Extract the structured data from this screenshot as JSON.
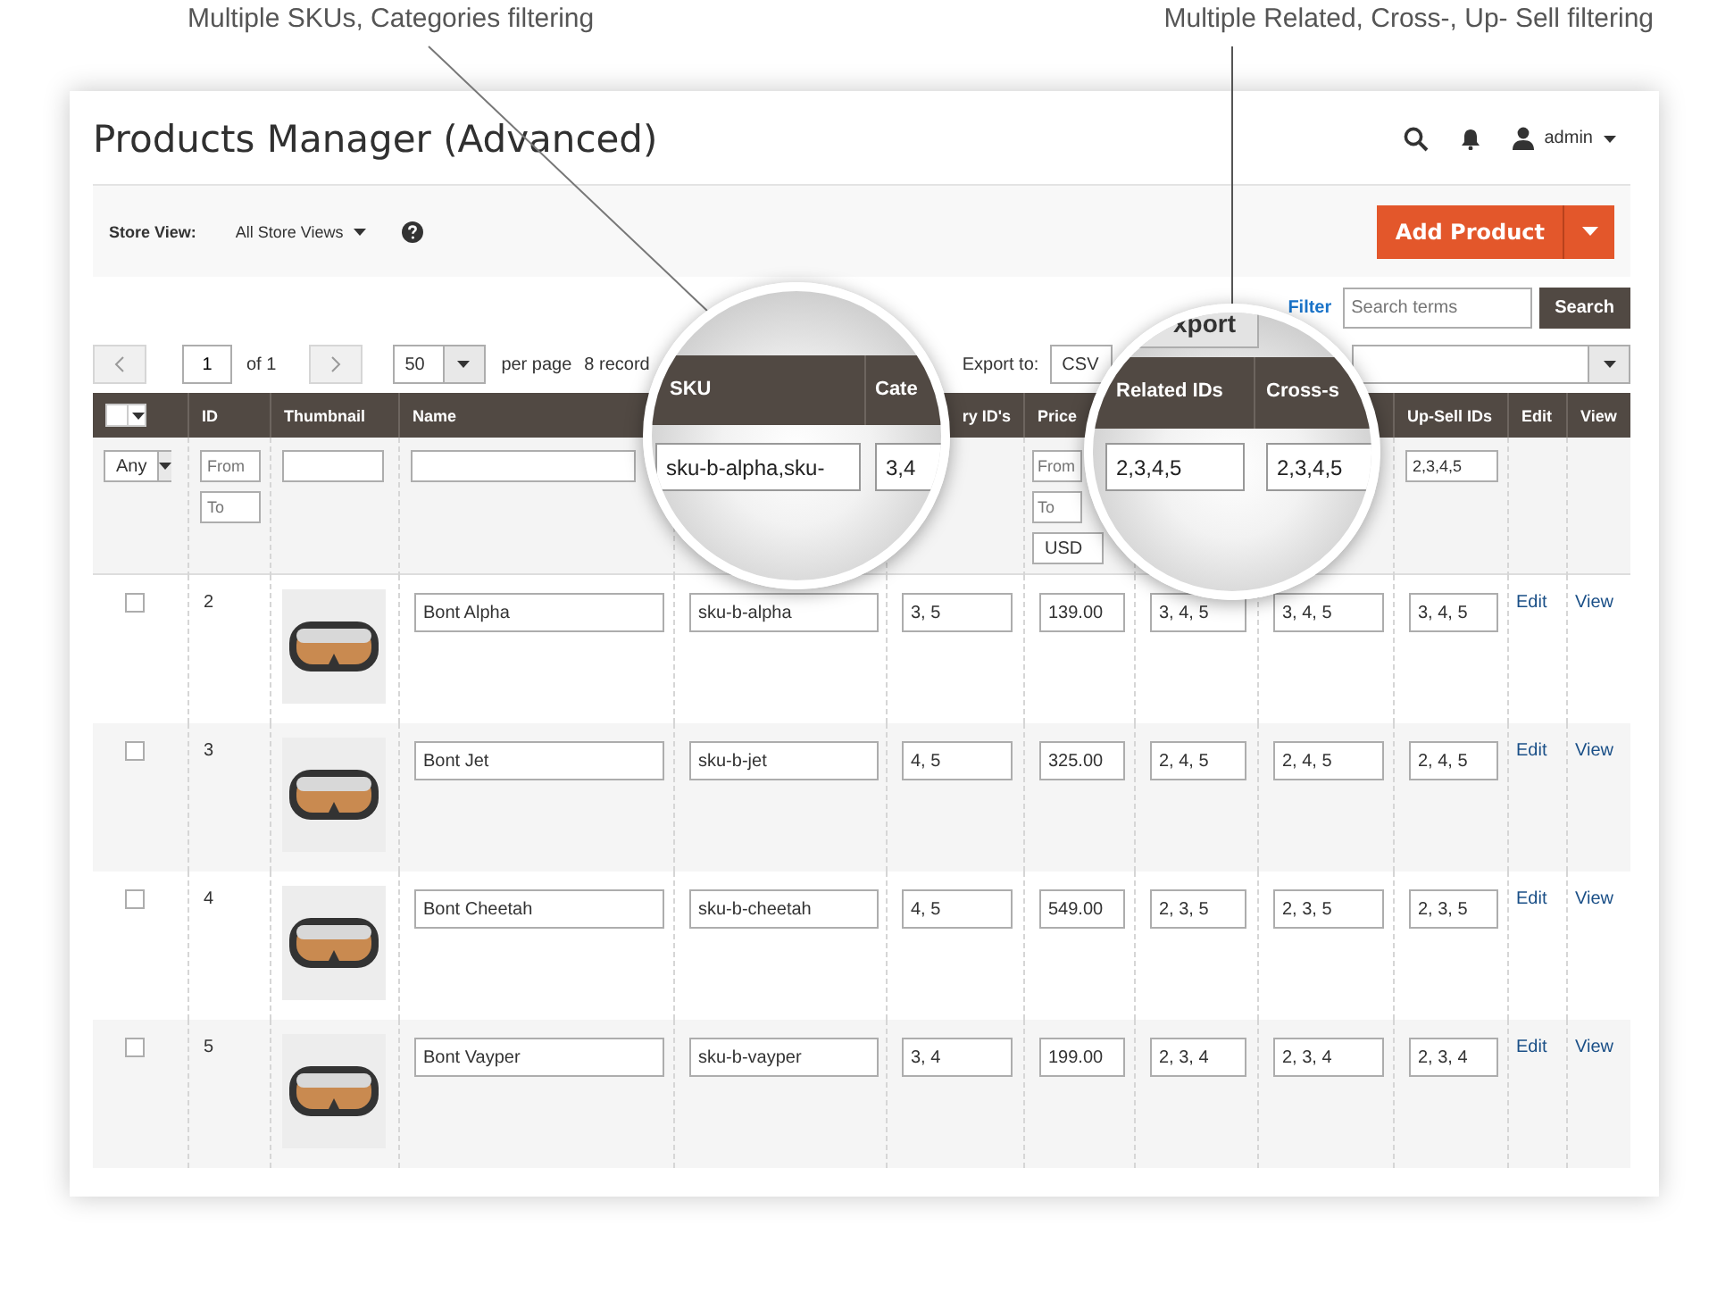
{
  "annotations": [
    {
      "text": "Multiple SKUs, Categories filtering"
    },
    {
      "text": "Multiple Related, Cross-, Up- Sell filtering"
    }
  ],
  "header": {
    "title": "Products Manager (Advanced)",
    "user": "admin"
  },
  "store_view": {
    "label": "Store View:",
    "value": "All Store Views"
  },
  "add_product": "Add Product",
  "toolbar": {
    "filter_link": "Filter",
    "search_placeholder": "Search terms",
    "search_button": "Search"
  },
  "pager": {
    "page": "1",
    "of": "of 1",
    "per_page_value": "50",
    "per_page_label": "per page",
    "records": "8 record"
  },
  "export": {
    "label": "Export to:",
    "format": "CSV"
  },
  "columns": [
    {
      "kind": "select"
    },
    {
      "kind": "text",
      "label": "ID"
    },
    {
      "kind": "text",
      "label": "Thumbnail"
    },
    {
      "kind": "text",
      "label": "Name"
    },
    {
      "kind": "covered"
    },
    {
      "kind": "text",
      "label": "ry ID's"
    },
    {
      "kind": "text",
      "label": "Price"
    },
    {
      "kind": "covered"
    },
    {
      "kind": "covered"
    },
    {
      "kind": "text",
      "label": "Up-Sell IDs"
    },
    {
      "kind": "text",
      "label": "Edit"
    },
    {
      "kind": "text",
      "label": "View"
    }
  ],
  "filters": {
    "mass_select": "Any",
    "id_from_placeholder": "From",
    "id_to_placeholder": "To",
    "price_from_placeholder": "From",
    "price_to_placeholder": "To",
    "currency": "USD",
    "up_sell": "2,3,4,5"
  },
  "magnifiers": [
    {
      "headers": [
        "SKU",
        "Cate"
      ],
      "values": [
        "sku-b-alpha,sku-",
        "3,4"
      ]
    },
    {
      "button": "xport",
      "headers": [
        "Related IDs",
        "Cross-s"
      ],
      "values": [
        "2,3,4,5",
        "2,3,4,5"
      ]
    }
  ],
  "rows": [
    {
      "checked": false,
      "id": "2",
      "name": "Bont Alpha",
      "sku": "sku-b-alpha",
      "categories": "3, 5",
      "price": "139.00",
      "related": "3, 4, 5",
      "cross_sell": "3, 4, 5",
      "up_sell": "3, 4, 5",
      "edit": "Edit",
      "view": "View"
    },
    {
      "checked": false,
      "id": "3",
      "name": "Bont Jet",
      "sku": "sku-b-jet",
      "categories": "4, 5",
      "price": "325.00",
      "related": "2, 4, 5",
      "cross_sell": "2, 4, 5",
      "up_sell": "2, 4, 5",
      "edit": "Edit",
      "view": "View"
    },
    {
      "checked": false,
      "id": "4",
      "name": "Bont Cheetah",
      "sku": "sku-b-cheetah",
      "categories": "4, 5",
      "price": "549.00",
      "related": "2, 3, 5",
      "cross_sell": "2, 3, 5",
      "up_sell": "2, 3, 5",
      "edit": "Edit",
      "view": "View"
    },
    {
      "checked": false,
      "id": "5",
      "name": "Bont Vayper",
      "sku": "sku-b-vayper",
      "categories": "3, 4",
      "price": "199.00",
      "related": "2, 3, 4",
      "cross_sell": "2, 3, 4",
      "up_sell": "2, 3, 4",
      "edit": "Edit",
      "view": "View"
    }
  ]
}
